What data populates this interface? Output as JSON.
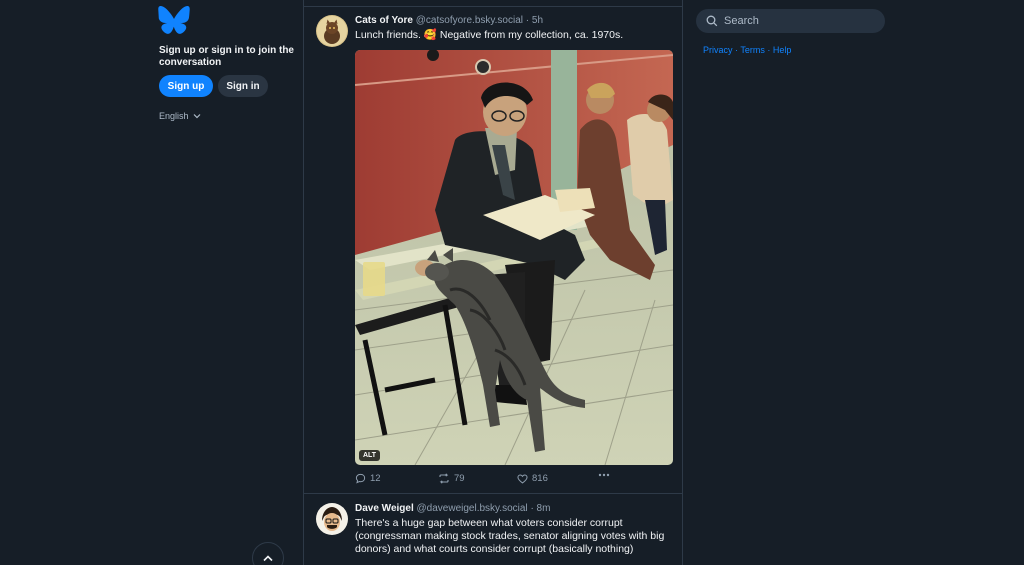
{
  "sidebar": {
    "join_text": "Sign up or sign in to join the conversation",
    "signup_label": "Sign up",
    "signin_label": "Sign in",
    "language": "English",
    "logo_icon": "butterfly-icon",
    "brand_color": "#1083fe"
  },
  "search": {
    "placeholder": "Search"
  },
  "footer_links": {
    "privacy": "Privacy",
    "terms": "Terms",
    "help": "Help",
    "separator": "·"
  },
  "posts": [
    {
      "author": "Cats of Yore",
      "handle": "@catsofyore.bsky.social",
      "time": "· 5h",
      "text_before": "Lunch friends. ",
      "emoji": "🥰",
      "text_after": " Negative from my collection, ca. 1970s.",
      "alt_badge": "ALT",
      "replies": "12",
      "reposts": "79",
      "likes": "816"
    },
    {
      "author": "Dave Weigel",
      "handle": "@daveweigel.bsky.social",
      "time": "· 8m",
      "text": "There's a huge gap between what voters consider corrupt (congressman making stock trades, senator aligning votes with big donors) and what courts consider corrupt (basically nothing)"
    }
  ]
}
